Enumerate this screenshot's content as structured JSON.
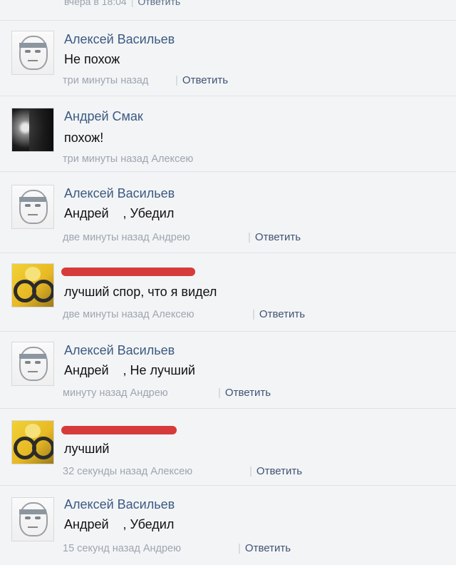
{
  "top_meta": {
    "time": "вчера в 18:04",
    "reply": "Ответить"
  },
  "comments": [
    {
      "author": "Алексей Васильев",
      "text": "Не похож",
      "time": "три минуты назад",
      "reply": "Ответить",
      "avatar": "sketch-avatar"
    },
    {
      "author": "Андрей Смак",
      "text": "похож!",
      "time": "три минуты назад Алексею",
      "reply": "",
      "avatar": "dark-photo-avatar"
    },
    {
      "author": "Алексей Васильев",
      "text": "Андрей    , Убедил",
      "time": "две минуты назад Андрею",
      "reply": "Ответить",
      "avatar": "sketch-avatar"
    },
    {
      "author": "",
      "text": "лучший спор, что я видел",
      "time": "две минуты назад Алексею",
      "reply": "Ответить",
      "avatar": "yellow-cartoon-avatar",
      "author_redacted": true
    },
    {
      "author": "Алексей Васильев",
      "text": "Андрей    , Не лучший",
      "time": "минуту назад Андрею",
      "reply": "Ответить",
      "avatar": "sketch-avatar"
    },
    {
      "author": "",
      "text": "лучший",
      "time": "32 секунды назад Алексею",
      "reply": "Ответить",
      "avatar": "yellow-cartoon-avatar",
      "author_redacted": true
    },
    {
      "author": "Алексей Васильев",
      "text": "Андрей    , Убедил",
      "time": "15 секунд назад Андрею",
      "reply": "Ответить",
      "avatar": "sketch-avatar"
    }
  ],
  "colors": {
    "background": "#f3f4f6",
    "author": "#3b5a82",
    "meta": "#9ea6b0",
    "redaction": "#d42a2a"
  }
}
